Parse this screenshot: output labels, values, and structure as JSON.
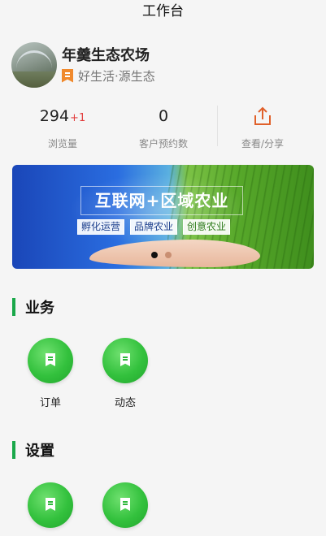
{
  "header": {
    "title": "工作台"
  },
  "profile": {
    "name": "年羹生态农场",
    "slogan": "好生活·源生态",
    "tag_color": "#f0892c"
  },
  "stats": {
    "views": {
      "value": "294",
      "increment": "+1",
      "label": "浏览量"
    },
    "reservations": {
      "value": "0",
      "label": "客户预约数"
    },
    "share": {
      "label": "查看/分享",
      "icon": "share-icon",
      "color": "#e0602a"
    }
  },
  "banner": {
    "title": "互联网+区域农业",
    "tags": [
      "孵化运营",
      "品牌农业",
      "创意农业"
    ],
    "active_slide": 1,
    "slide_count": 2
  },
  "sections": {
    "business": {
      "title": "业务",
      "items": [
        {
          "label": "订单",
          "icon": "bookmark-icon"
        },
        {
          "label": "动态",
          "icon": "bookmark-icon"
        }
      ]
    },
    "settings": {
      "title": "设置",
      "items": [
        {
          "label": "",
          "icon": "bookmark-icon"
        },
        {
          "label": "",
          "icon": "bookmark-icon"
        }
      ]
    }
  },
  "colors": {
    "accent": "#1aa84a",
    "increment": "#e23d3d",
    "tile_green": "#33c13d"
  }
}
